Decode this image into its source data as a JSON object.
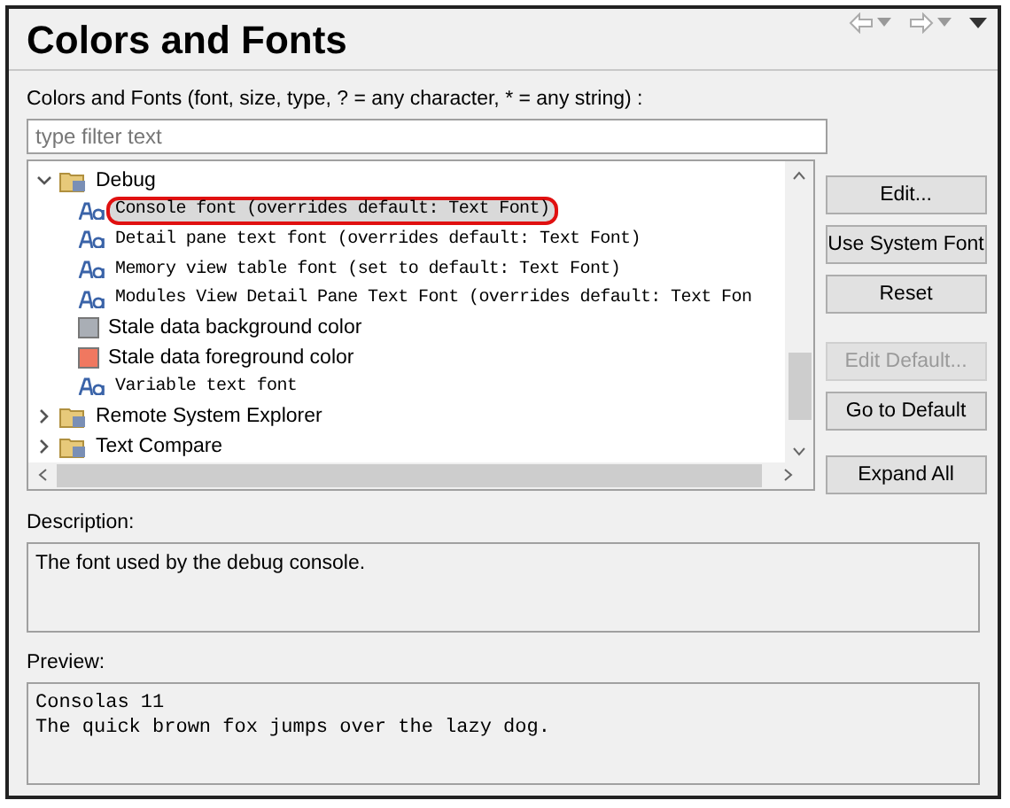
{
  "header": {
    "title": "Colors and Fonts"
  },
  "filter": {
    "label": "Colors and Fonts (font, size, type, ? = any character, * = any string) :",
    "placeholder": "type filter text"
  },
  "tree": [
    {
      "label": "Debug",
      "kind": "folder",
      "expanded": true,
      "selected": false,
      "children": [
        {
          "label": "Console font (overrides default: Text Font)",
          "kind": "font",
          "selected": true,
          "circled": true
        },
        {
          "label": "Detail pane text font (overrides default: Text Font)",
          "kind": "font",
          "selected": false,
          "circled": false
        },
        {
          "label": "Memory view table font (set to default: Text Font)",
          "kind": "font",
          "selected": false,
          "circled": false
        },
        {
          "label": "Modules View Detail Pane Text Font (overrides default: Text Fon",
          "kind": "font",
          "selected": false,
          "circled": false
        },
        {
          "label": "Stale data background color",
          "kind": "color",
          "color": "#a9aeb5",
          "selected": false,
          "circled": false
        },
        {
          "label": "Stale data foreground color",
          "kind": "color",
          "color": "#f07860",
          "selected": false,
          "circled": false
        },
        {
          "label": "Variable text font",
          "kind": "font",
          "selected": false,
          "circled": false
        }
      ]
    },
    {
      "label": "Remote System Explorer",
      "kind": "folder",
      "expanded": false,
      "selected": false
    },
    {
      "label": "Text Compare",
      "kind": "folder",
      "expanded": false,
      "selected": false
    }
  ],
  "buttons": [
    {
      "label": "Edit...",
      "disabled": false
    },
    {
      "label": "Use System Font",
      "disabled": false
    },
    {
      "label": "Reset",
      "disabled": false
    },
    {
      "label": "Edit Default...",
      "disabled": true
    },
    {
      "label": "Go to Default",
      "disabled": false
    },
    {
      "label": "Expand All",
      "disabled": false
    }
  ],
  "description": {
    "label": "Description:",
    "text": "The font used by the debug console."
  },
  "preview": {
    "label": "Preview:",
    "lines": [
      "Consolas 11",
      "The quick brown fox jumps over the lazy dog."
    ]
  }
}
